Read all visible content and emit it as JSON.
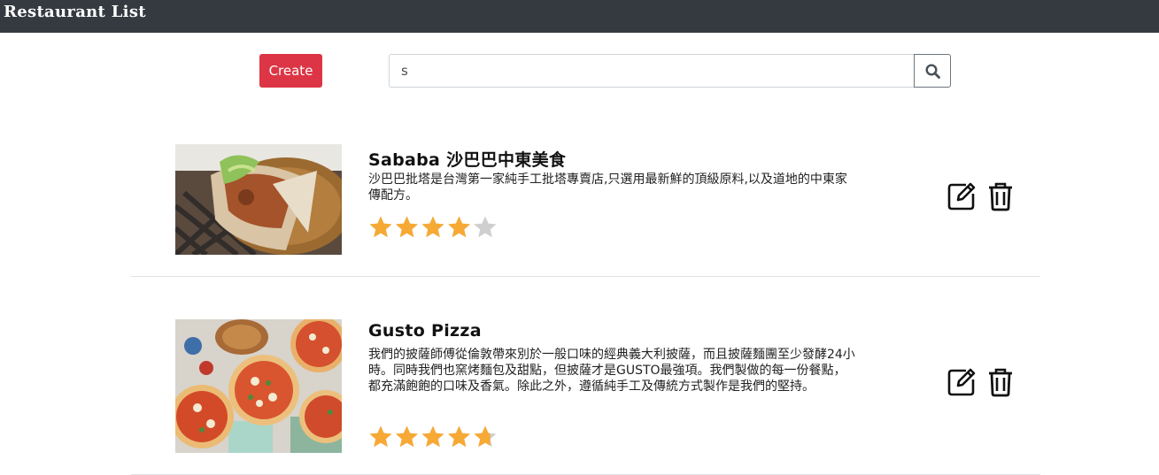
{
  "navbar": {
    "brand": "Restaurant List"
  },
  "toolbar": {
    "create_label": "Create"
  },
  "search": {
    "value": "s",
    "icon": "search-icon"
  },
  "restaurants": [
    {
      "name": "Sababa 沙巴巴中東美食",
      "description": "沙巴巴批塔是台灣第一家純手工批塔專賣店,只選用最新鮮的頂級原料,以及道地的中東家傳配方。",
      "rating": 4.1,
      "rating_max": 5
    },
    {
      "name": "Gusto Pizza",
      "description": "我們的披薩師傅從倫敦帶來別於一般口味的經典義大利披薩，而且披薩麵團至少發酵24小時。同時我們也窯烤麵包及甜點，但披薩才是GUSTO最強項。我們製做的每一份餐點，都充滿飽飽的口味及香氣。除此之外，遵循純手工及傳統方式製作是我們的堅持。",
      "rating": 4.7,
      "rating_max": 5
    }
  ],
  "colors": {
    "navbar": "#343a40",
    "create_button": "#dc3545",
    "star_filled": "#f7a935",
    "star_empty": "#cfcfcf"
  }
}
